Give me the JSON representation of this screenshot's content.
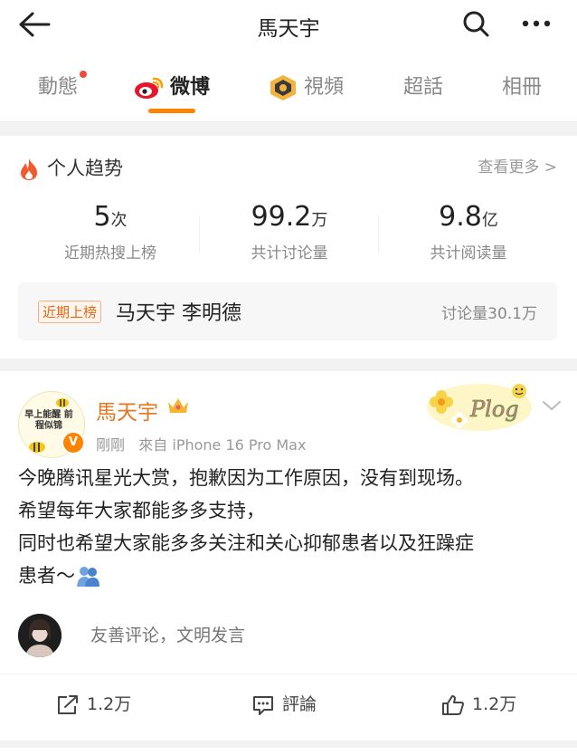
{
  "header": {
    "title": "馬天宇"
  },
  "tabs": [
    {
      "label": "動態"
    },
    {
      "label": "微博"
    },
    {
      "label": "視頻"
    },
    {
      "label": "超話"
    },
    {
      "label": "相冊"
    }
  ],
  "trend": {
    "title": "个人趋势",
    "more": "查看更多 >",
    "stats": [
      {
        "value": "5",
        "unit": "次",
        "label": "近期热搜上榜"
      },
      {
        "value": "99.2",
        "unit": "万",
        "label": "共计讨论量"
      },
      {
        "value": "9.8",
        "unit": "亿",
        "label": "共计阅读量"
      }
    ],
    "hot": {
      "badge": "近期上榜",
      "names": "马天宇 李明德",
      "count": "讨论量30.1万"
    }
  },
  "post": {
    "avatar_text": "早上能醒 前程似锦",
    "author": "馬天宇",
    "time": "剛剛",
    "source": "來自 iPhone 16 Pro Max",
    "sticker_text": "Plog",
    "lines": [
      "今晚腾讯星光大赏，抱歉因为工作原因，没有到现场。",
      "希望每年大家都能多多支持，",
      "同时也希望大家能多多关注和关心抑郁患者以及狂躁症",
      "患者～"
    ],
    "comment_placeholder": "友善评论，文明发言",
    "repost": "1.2万",
    "comment": "評論",
    "like": "1.2万"
  },
  "colors": {
    "accent": "#ff8200",
    "author": "#e8761f",
    "badge": "#e06a1a"
  }
}
